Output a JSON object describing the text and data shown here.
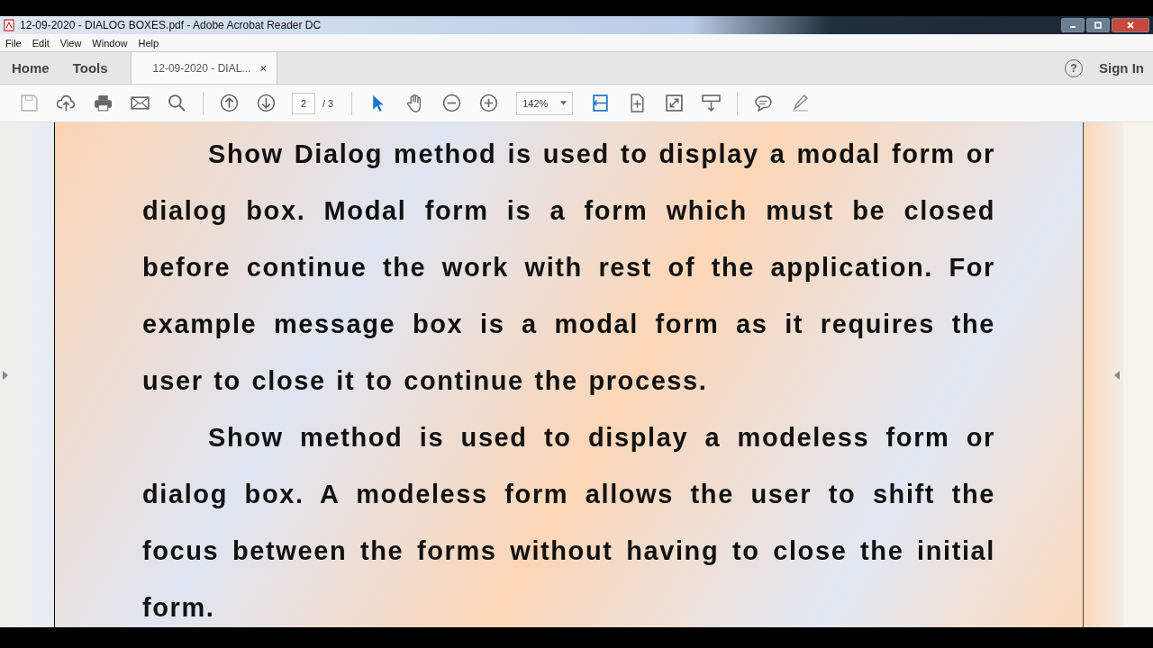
{
  "window": {
    "title": "12-09-2020 - DIALOG BOXES.pdf - Adobe Acrobat Reader DC"
  },
  "menu": [
    "File",
    "Edit",
    "View",
    "Window",
    "Help"
  ],
  "tabs": [
    {
      "label": "Home",
      "selected": false
    },
    {
      "label": "Tools",
      "selected": false
    },
    {
      "label": "12-09-2020 - DIAL...",
      "selected": true,
      "close": "×"
    }
  ],
  "account": {
    "help": "?",
    "sign_in": "Sign In"
  },
  "toolbar": {
    "page": "2",
    "page_total": "/ 3",
    "zoom": "142%"
  },
  "document": {
    "paragraphs": [
      "Show Dialog method is used to display a modal form or dialog box. Modal form is a form which must be closed before continue the work with rest of the application. For example message box is a modal form as it requires the user to close it to continue the process.",
      "Show method is used to display a modeless form or dialog box. A modeless form allows the user to shift the focus between the forms without having to close the initial form."
    ]
  }
}
